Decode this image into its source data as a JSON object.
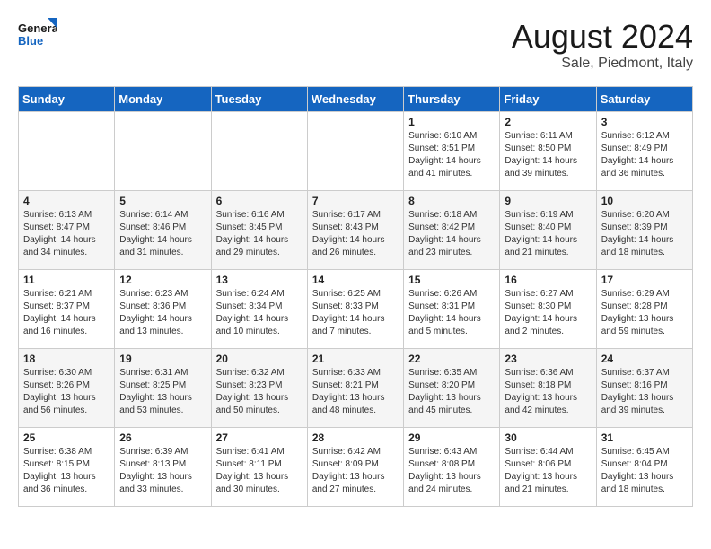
{
  "header": {
    "logo_line1": "General",
    "logo_line2": "Blue",
    "title": "August 2024",
    "subtitle": "Sale, Piedmont, Italy"
  },
  "days_of_week": [
    "Sunday",
    "Monday",
    "Tuesday",
    "Wednesday",
    "Thursday",
    "Friday",
    "Saturday"
  ],
  "weeks": [
    {
      "days": [
        {
          "number": "",
          "info": ""
        },
        {
          "number": "",
          "info": ""
        },
        {
          "number": "",
          "info": ""
        },
        {
          "number": "",
          "info": ""
        },
        {
          "number": "1",
          "info": "Sunrise: 6:10 AM\nSunset: 8:51 PM\nDaylight: 14 hours\nand 41 minutes."
        },
        {
          "number": "2",
          "info": "Sunrise: 6:11 AM\nSunset: 8:50 PM\nDaylight: 14 hours\nand 39 minutes."
        },
        {
          "number": "3",
          "info": "Sunrise: 6:12 AM\nSunset: 8:49 PM\nDaylight: 14 hours\nand 36 minutes."
        }
      ]
    },
    {
      "days": [
        {
          "number": "4",
          "info": "Sunrise: 6:13 AM\nSunset: 8:47 PM\nDaylight: 14 hours\nand 34 minutes."
        },
        {
          "number": "5",
          "info": "Sunrise: 6:14 AM\nSunset: 8:46 PM\nDaylight: 14 hours\nand 31 minutes."
        },
        {
          "number": "6",
          "info": "Sunrise: 6:16 AM\nSunset: 8:45 PM\nDaylight: 14 hours\nand 29 minutes."
        },
        {
          "number": "7",
          "info": "Sunrise: 6:17 AM\nSunset: 8:43 PM\nDaylight: 14 hours\nand 26 minutes."
        },
        {
          "number": "8",
          "info": "Sunrise: 6:18 AM\nSunset: 8:42 PM\nDaylight: 14 hours\nand 23 minutes."
        },
        {
          "number": "9",
          "info": "Sunrise: 6:19 AM\nSunset: 8:40 PM\nDaylight: 14 hours\nand 21 minutes."
        },
        {
          "number": "10",
          "info": "Sunrise: 6:20 AM\nSunset: 8:39 PM\nDaylight: 14 hours\nand 18 minutes."
        }
      ]
    },
    {
      "days": [
        {
          "number": "11",
          "info": "Sunrise: 6:21 AM\nSunset: 8:37 PM\nDaylight: 14 hours\nand 16 minutes."
        },
        {
          "number": "12",
          "info": "Sunrise: 6:23 AM\nSunset: 8:36 PM\nDaylight: 14 hours\nand 13 minutes."
        },
        {
          "number": "13",
          "info": "Sunrise: 6:24 AM\nSunset: 8:34 PM\nDaylight: 14 hours\nand 10 minutes."
        },
        {
          "number": "14",
          "info": "Sunrise: 6:25 AM\nSunset: 8:33 PM\nDaylight: 14 hours\nand 7 minutes."
        },
        {
          "number": "15",
          "info": "Sunrise: 6:26 AM\nSunset: 8:31 PM\nDaylight: 14 hours\nand 5 minutes."
        },
        {
          "number": "16",
          "info": "Sunrise: 6:27 AM\nSunset: 8:30 PM\nDaylight: 14 hours\nand 2 minutes."
        },
        {
          "number": "17",
          "info": "Sunrise: 6:29 AM\nSunset: 8:28 PM\nDaylight: 13 hours\nand 59 minutes."
        }
      ]
    },
    {
      "days": [
        {
          "number": "18",
          "info": "Sunrise: 6:30 AM\nSunset: 8:26 PM\nDaylight: 13 hours\nand 56 minutes."
        },
        {
          "number": "19",
          "info": "Sunrise: 6:31 AM\nSunset: 8:25 PM\nDaylight: 13 hours\nand 53 minutes."
        },
        {
          "number": "20",
          "info": "Sunrise: 6:32 AM\nSunset: 8:23 PM\nDaylight: 13 hours\nand 50 minutes."
        },
        {
          "number": "21",
          "info": "Sunrise: 6:33 AM\nSunset: 8:21 PM\nDaylight: 13 hours\nand 48 minutes."
        },
        {
          "number": "22",
          "info": "Sunrise: 6:35 AM\nSunset: 8:20 PM\nDaylight: 13 hours\nand 45 minutes."
        },
        {
          "number": "23",
          "info": "Sunrise: 6:36 AM\nSunset: 8:18 PM\nDaylight: 13 hours\nand 42 minutes."
        },
        {
          "number": "24",
          "info": "Sunrise: 6:37 AM\nSunset: 8:16 PM\nDaylight: 13 hours\nand 39 minutes."
        }
      ]
    },
    {
      "days": [
        {
          "number": "25",
          "info": "Sunrise: 6:38 AM\nSunset: 8:15 PM\nDaylight: 13 hours\nand 36 minutes."
        },
        {
          "number": "26",
          "info": "Sunrise: 6:39 AM\nSunset: 8:13 PM\nDaylight: 13 hours\nand 33 minutes."
        },
        {
          "number": "27",
          "info": "Sunrise: 6:41 AM\nSunset: 8:11 PM\nDaylight: 13 hours\nand 30 minutes."
        },
        {
          "number": "28",
          "info": "Sunrise: 6:42 AM\nSunset: 8:09 PM\nDaylight: 13 hours\nand 27 minutes."
        },
        {
          "number": "29",
          "info": "Sunrise: 6:43 AM\nSunset: 8:08 PM\nDaylight: 13 hours\nand 24 minutes."
        },
        {
          "number": "30",
          "info": "Sunrise: 6:44 AM\nSunset: 8:06 PM\nDaylight: 13 hours\nand 21 minutes."
        },
        {
          "number": "31",
          "info": "Sunrise: 6:45 AM\nSunset: 8:04 PM\nDaylight: 13 hours\nand 18 minutes."
        }
      ]
    }
  ]
}
